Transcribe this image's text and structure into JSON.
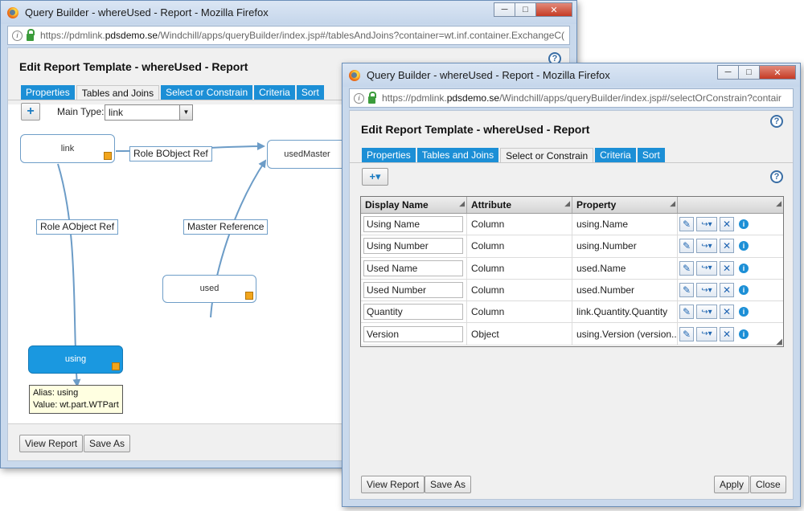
{
  "window1": {
    "title": "Query Builder - whereUsed - Report - Mozilla Firefox",
    "url_prefix": "https://pdmlink.",
    "url_domain": "pdsdemo.se",
    "url_rest": "/Windchill/apps/queryBuilder/index.jsp#/tablesAndJoins?container=wt.inf.container.ExchangeC(",
    "report_title": "Edit Report Template - whereUsed - Report",
    "tabs": [
      "Properties",
      "Tables and Joins",
      "Select or Constrain",
      "Criteria",
      "Sort"
    ],
    "active_tab": "Tables and Joins",
    "add_label": "+",
    "main_type_label": "Main Type:",
    "main_type_value": "link",
    "nodes": {
      "link": "link",
      "usedMaster": "usedMaster",
      "used": "used",
      "using": "using"
    },
    "edges": {
      "role_b": "Role BObject Ref",
      "role_a": "Role AObject Ref",
      "master_ref": "Master Reference"
    },
    "tooltip": {
      "alias": "Alias: using",
      "value": "Value: wt.part.WTPart"
    },
    "buttons": {
      "view_report": "View Report",
      "save_as": "Save As"
    },
    "window_controls": {
      "minimize": "─",
      "maximize": "□",
      "close": "✕"
    }
  },
  "window2": {
    "title": "Query Builder - whereUsed - Report - Mozilla Firefox",
    "url_prefix": "https://pdmlink.",
    "url_domain": "pdsdemo.se",
    "url_rest": "/Windchill/apps/queryBuilder/index.jsp#/selectOrConstrain?contair",
    "report_title": "Edit Report Template - whereUsed - Report",
    "tabs": [
      "Properties",
      "Tables and Joins",
      "Select or Constrain",
      "Criteria",
      "Sort"
    ],
    "active_tab": "Select or Constrain",
    "add_label": "+▾",
    "columns": [
      "Display Name",
      "Attribute",
      "Property",
      ""
    ],
    "rows": [
      {
        "display_name": "Using Name",
        "attribute": "Column",
        "property": "using.Name"
      },
      {
        "display_name": "Using Number",
        "attribute": "Column",
        "property": "using.Number"
      },
      {
        "display_name": "Used Name",
        "attribute": "Column",
        "property": "used.Name"
      },
      {
        "display_name": "Used Number",
        "attribute": "Column",
        "property": "used.Number"
      },
      {
        "display_name": "Quantity",
        "attribute": "Column",
        "property": "link.Quantity.Quantity"
      },
      {
        "display_name": "Version",
        "attribute": "Object",
        "property": "using.Version (version..."
      }
    ],
    "buttons": {
      "view_report": "View Report",
      "save_as": "Save As",
      "apply": "Apply",
      "close": "Close"
    },
    "window_controls": {
      "minimize": "─",
      "maximize": "□",
      "close": "✕"
    }
  },
  "icons": {
    "help": "?",
    "edit": "✎",
    "join": "↪▾",
    "delete": "✕",
    "info": "i",
    "dropdown": "▼"
  },
  "colors": {
    "tab_blue": "#1c8fd6",
    "selected_node": "#1a98e0",
    "node_corner": "#f2a51c"
  }
}
